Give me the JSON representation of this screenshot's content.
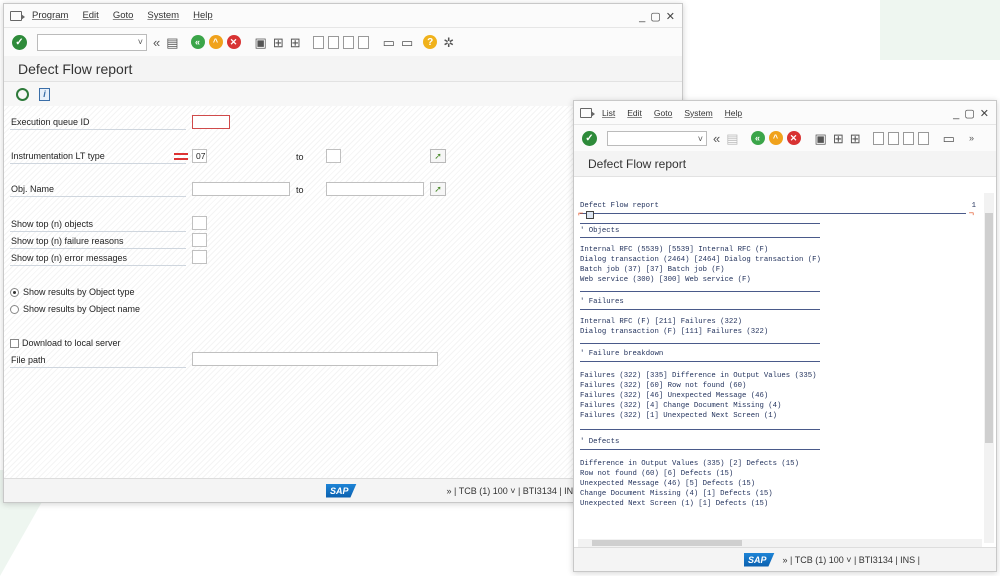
{
  "window1": {
    "menu": [
      "Program",
      "Edit",
      "Goto",
      "System",
      "Help"
    ],
    "win_controls": "_ ▢ ✕",
    "title": "Defect Flow report",
    "fields": {
      "exec_queue_label": "Execution queue ID",
      "instr_label": "Instrumentation LT type",
      "instr_value": "07",
      "to1": "to",
      "objname_label": "Obj. Name",
      "to2": "to",
      "top_objects_label": "Show top (n) objects",
      "top_failure_label": "Show top (n) failure reasons",
      "top_error_label": "Show top (n) error messages",
      "radio_type_label": "Show results by Object type",
      "radio_name_label": "Show results by Object name",
      "download_label": "Download to local server",
      "filepath_label": "File path"
    },
    "status": {
      "sap": "SAP",
      "text": "» | TCB (1) 100 ˅ | BTI3134 | IN"
    }
  },
  "window2": {
    "menu": [
      "List",
      "Edit",
      "Goto",
      "System",
      "Help"
    ],
    "win_controls": "_ ▢ ✕",
    "title": "Defect Flow report",
    "report_header": "Defect Flow report",
    "page_no": "1",
    "sections": {
      "objects": "Objects",
      "failures": "Failures",
      "breakdown": "Failure breakdown",
      "defects": "Defects"
    },
    "objects_lines": [
      "Internal RFC (5539) [5539] Internal RFC (F)",
      "Dialog transaction (2464) [2464] Dialog transaction (F)",
      "Batch job (37) [37] Batch job (F)",
      "Web service (300) [300] Web service (F)"
    ],
    "failures_lines": [
      "Internal RFC (F) [211] Failures (322)",
      "Dialog transaction (F) [111] Failures (322)"
    ],
    "breakdown_lines": [
      "Failures (322) [335] Difference in Output Values (335)",
      "Failures (322) [60] Row not found (60)",
      "Failures (322) [46] Unexpected Message (46)",
      "Failures (322) [4] Change Document Missing (4)",
      "Failures (322) [1] Unexpected Next Screen (1)"
    ],
    "defects_lines": [
      "Difference in Output Values (335) [2] Defects (15)",
      "Row not found (60) [6] Defects (15)",
      "Unexpected Message (46) [5] Defects (15)",
      "Change Document Missing (4) [1] Defects (15)",
      "Unexpected Next Screen (1) [1] Defects (15)"
    ],
    "status": {
      "sap": "SAP",
      "text": "» | TCB (1) 100 ˅ | BTI3134 | INS |"
    }
  }
}
